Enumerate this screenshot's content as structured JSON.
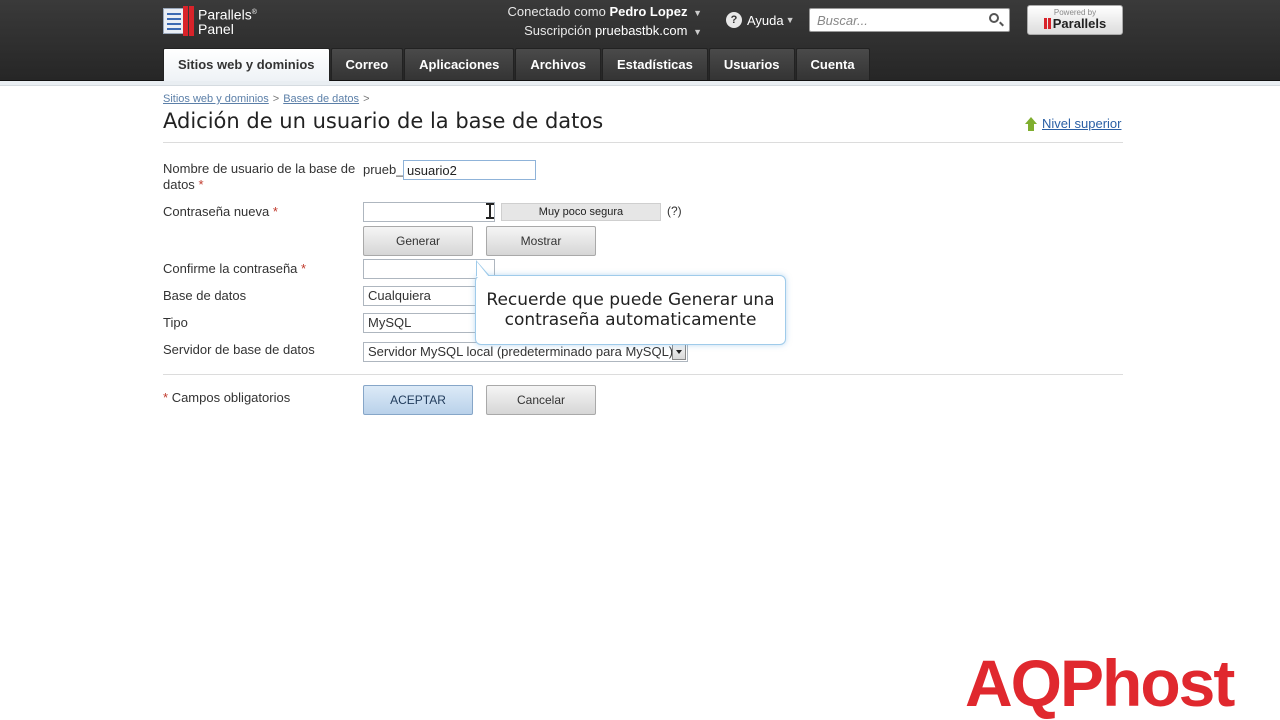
{
  "header": {
    "logo_line1": "Parallels",
    "logo_line2": "Panel",
    "connected_prefix": "Conectado como",
    "connected_user": "Pedro Lopez",
    "subscription_prefix": "Suscripción",
    "subscription_value": "pruebastbk.com",
    "help_label": "Ayuda",
    "search_placeholder": "Buscar...",
    "powered_by": "Powered by",
    "powered_brand": "Parallels"
  },
  "tabs": [
    {
      "label": "Sitios web y dominios",
      "active": true
    },
    {
      "label": "Correo"
    },
    {
      "label": "Aplicaciones"
    },
    {
      "label": "Archivos"
    },
    {
      "label": "Estadísticas"
    },
    {
      "label": "Usuarios"
    },
    {
      "label": "Cuenta"
    }
  ],
  "breadcrumb": [
    "Sitios web y dominios",
    "Bases de datos"
  ],
  "page_title": "Adición de un usuario de la base de datos",
  "up_level_label": "Nivel superior",
  "form": {
    "username_label_line1": "Nombre de usuario de la base de",
    "username_label_line2": "datos",
    "username_prefix": "prueb_",
    "username_value": "usuario2",
    "password_label": "Contraseña nueva",
    "password_value": "",
    "strength_text": "Muy poco segura",
    "strength_help": "(?)",
    "generate_label": "Generar",
    "show_label": "Mostrar",
    "confirm_label": "Confirme la contraseña",
    "confirm_value": "",
    "database_label": "Base de datos",
    "database_value": "Cualquiera",
    "type_label": "Tipo",
    "type_value": "MySQL",
    "server_label": "Servidor de base de datos",
    "server_value": "Servidor MySQL local (predeterminado para MySQL)",
    "required_note": "Campos obligatorios",
    "ok_label": "ACEPTAR",
    "cancel_label": "Cancelar",
    "required_mark": "*"
  },
  "tooltip": {
    "line1": "Recuerde que puede Generar una",
    "line2": "contraseña automaticamente"
  },
  "watermark": "AQPhost",
  "colors": {
    "accent": "#2a5fa5",
    "required": "#c0392b",
    "watermark": "#e0282e",
    "header": "#2e2e2e"
  }
}
